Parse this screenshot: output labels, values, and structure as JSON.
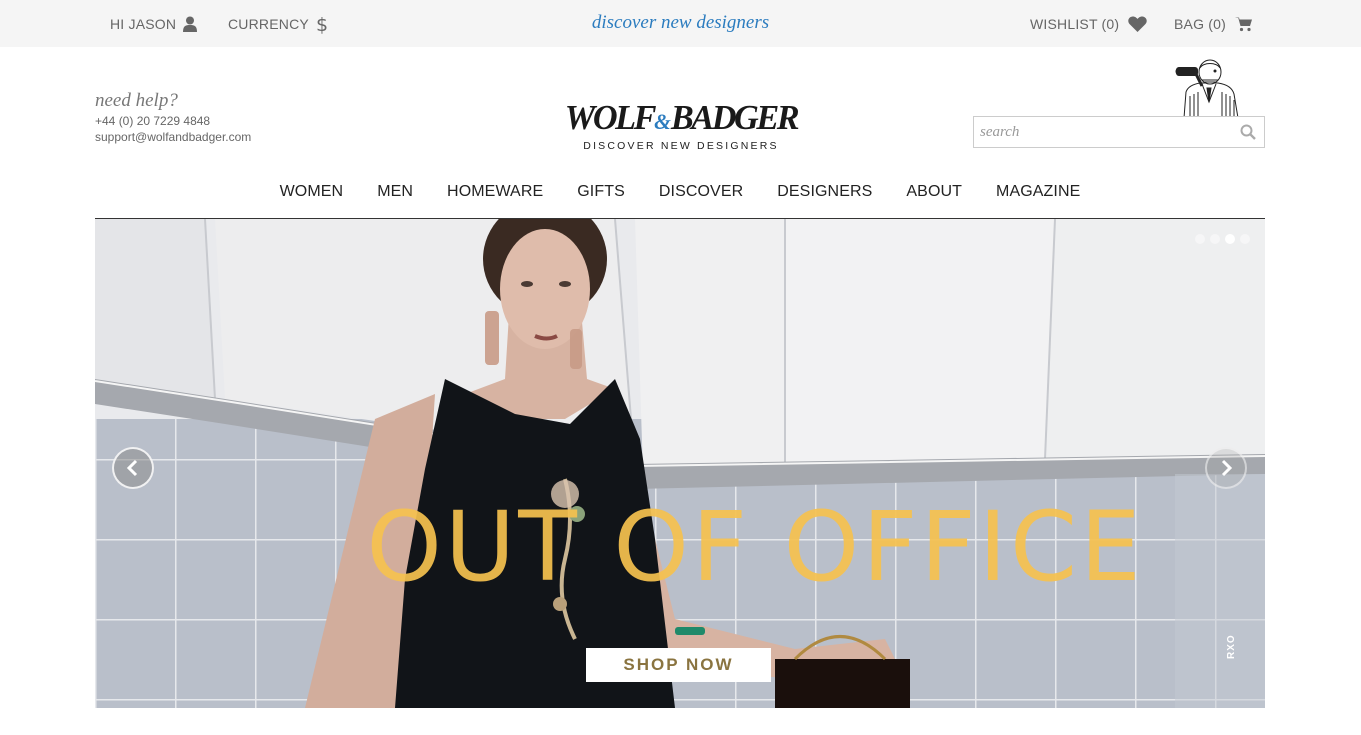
{
  "topbar": {
    "greeting": "HI JASON",
    "currency": "CURRENCY",
    "tagline": "discover new designers",
    "wishlist": "WISHLIST (0)",
    "bag": "BAG (0)"
  },
  "help": {
    "title": "need help?",
    "phone": "+44 (0) 20 7229 4848",
    "email": "support@wolfandbadger.com"
  },
  "logo": {
    "part1": "WOLF",
    "amp": "&",
    "part2": "BADGER",
    "subtitle": "DISCOVER NEW DESIGNERS"
  },
  "search": {
    "placeholder": "search"
  },
  "nav": {
    "items": [
      "WOMEN",
      "MEN",
      "HOMEWARE",
      "GIFTS",
      "DISCOVER",
      "DESIGNERS",
      "ABOUT",
      "MAGAZINE"
    ]
  },
  "hero": {
    "headline": "OUT OF OFFICE",
    "cta": "SHOP NOW",
    "credit": "RXO",
    "active_slide": 3,
    "slide_count": 4
  },
  "colors": {
    "accent_blue": "#2b7cbf",
    "headline_yellow": "#f6c24f",
    "cta_text": "#8a7440",
    "topbar_bg": "#f5f5f5"
  },
  "icons": [
    "user-icon",
    "dollar-icon",
    "heart-icon",
    "cart-icon",
    "search-icon",
    "chevron-left-icon",
    "chevron-right-icon",
    "mascot-illustration"
  ]
}
